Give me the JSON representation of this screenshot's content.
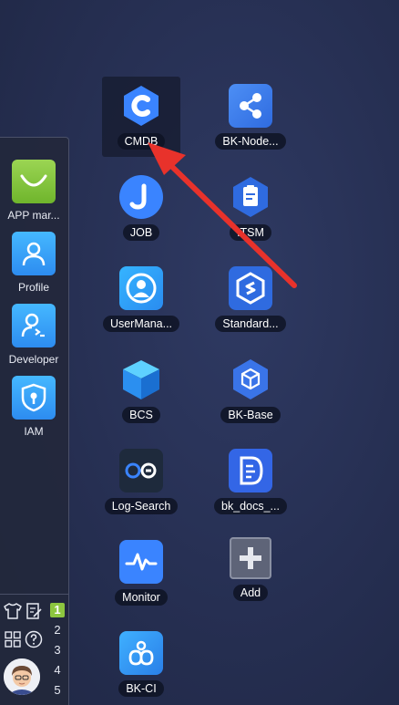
{
  "dock": {
    "apps": [
      {
        "label": "APP mar...",
        "icon": "shopping-bag-icon"
      },
      {
        "label": "Profile",
        "icon": "user-icon"
      },
      {
        "label": "Developer",
        "icon": "developer-icon"
      },
      {
        "label": "IAM",
        "icon": "shield-lock-icon"
      }
    ],
    "desktops": [
      "1",
      "2",
      "3",
      "4",
      "5"
    ],
    "active_desktop": "1"
  },
  "desktop": {
    "apps": [
      {
        "label": "CMDB",
        "icon": "cmdb-icon"
      },
      {
        "label": "BK-Node...",
        "icon": "nodes-icon"
      },
      {
        "label": "JOB",
        "icon": "job-icon"
      },
      {
        "label": "ITSM",
        "icon": "itsm-icon"
      },
      {
        "label": "UserMana...",
        "icon": "user-management-icon"
      },
      {
        "label": "Standard...",
        "icon": "standard-ops-icon"
      },
      {
        "label": "BCS",
        "icon": "container-cube-icon"
      },
      {
        "label": "BK-Base",
        "icon": "base-cube-icon"
      },
      {
        "label": "Log-Search",
        "icon": "log-search-icon"
      },
      {
        "label": "bk_docs_...",
        "icon": "docs-icon"
      },
      {
        "label": "Monitor",
        "icon": "monitor-icon"
      },
      {
        "label": "Add",
        "icon": "plus-icon"
      },
      {
        "label": "BK-CI",
        "icon": "ci-icon"
      }
    ]
  },
  "colors": {
    "background": "#262f52",
    "accent_blue": "#3a84ff",
    "active_desktop": "#8dc63f",
    "annotation_arrow": "#e8322b"
  }
}
